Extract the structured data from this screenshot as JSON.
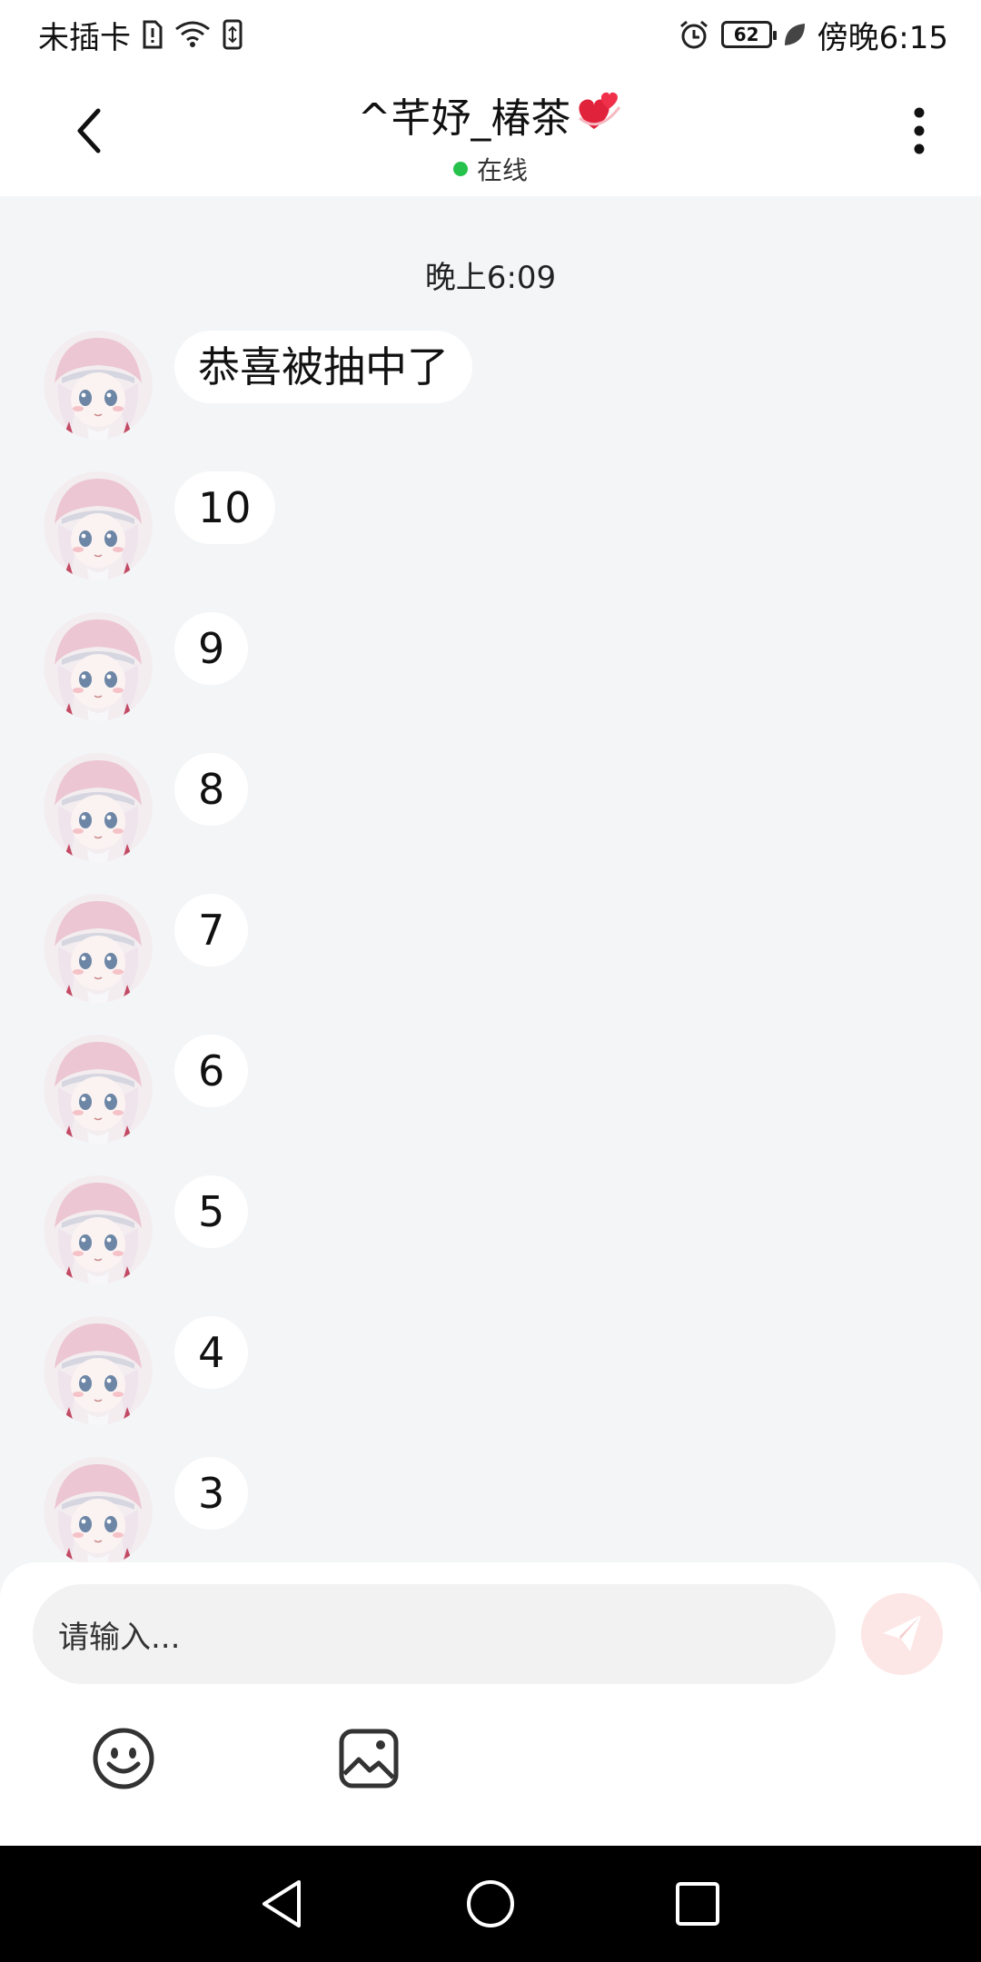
{
  "status_bar": {
    "carrier": "未插卡",
    "battery": "62",
    "time": "傍晚6:15"
  },
  "header": {
    "title": "^芊妤_椿茶",
    "title_emoji": "💞",
    "status": "在线"
  },
  "chat": {
    "timestamp": "晚上6:09",
    "messages": [
      {
        "text": "恭喜被抽中了"
      },
      {
        "text": "10"
      },
      {
        "text": "9"
      },
      {
        "text": "8"
      },
      {
        "text": "7"
      },
      {
        "text": "6"
      },
      {
        "text": "5"
      },
      {
        "text": "4"
      },
      {
        "text": "3"
      }
    ]
  },
  "input": {
    "placeholder": "请输入..."
  },
  "colors": {
    "online": "#27c24c",
    "send_button_bg": "#fde6e6",
    "chat_bg": "#f4f5f7"
  },
  "icons": {
    "back": "chevron-left-icon",
    "more": "more-vertical-icon",
    "send": "send-icon",
    "emoji": "emoji-icon",
    "image": "image-icon"
  }
}
